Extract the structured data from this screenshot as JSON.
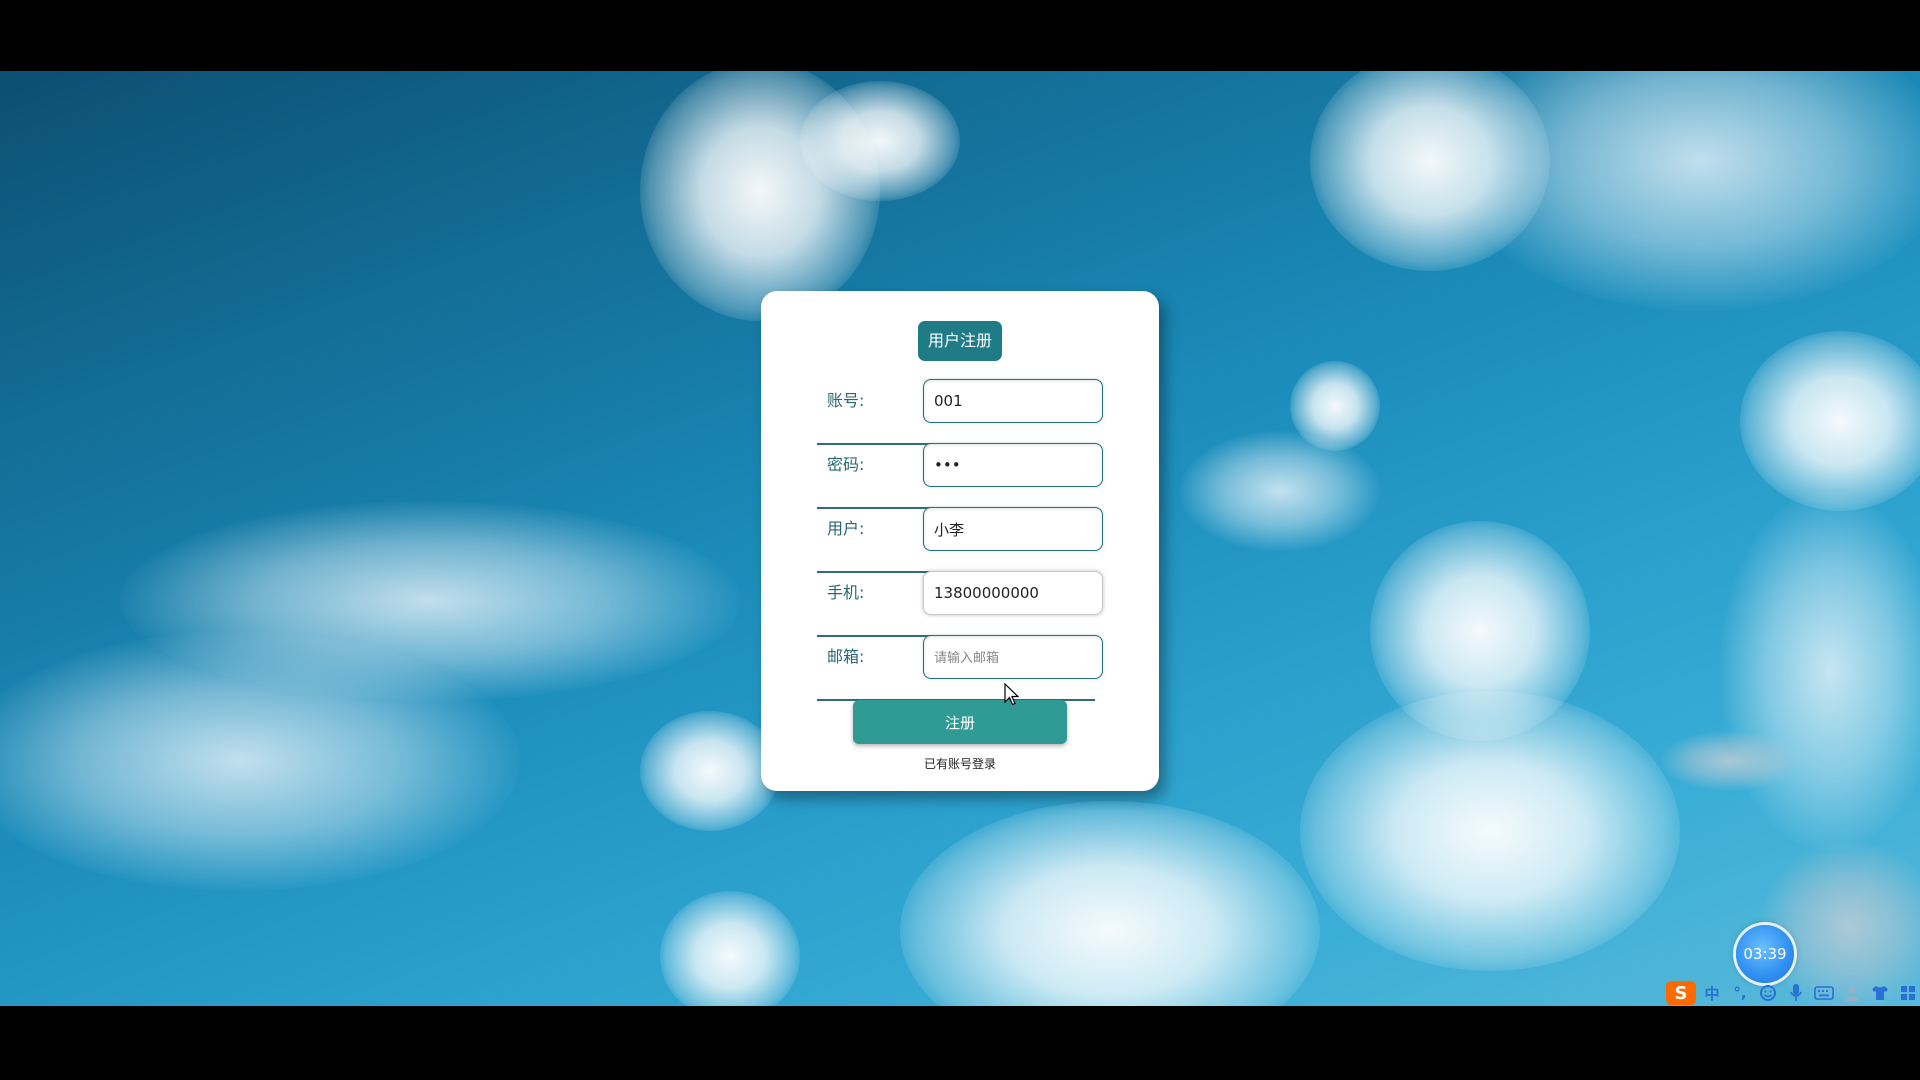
{
  "form": {
    "title": "用户注册",
    "fields": [
      {
        "label": "账号:",
        "value": "001",
        "placeholder": "",
        "type": "text"
      },
      {
        "label": "密码:",
        "value": "•••",
        "placeholder": "",
        "type": "text"
      },
      {
        "label": "用户:",
        "value": "小李",
        "placeholder": "",
        "type": "text"
      },
      {
        "label": "手机:",
        "value": "13800000000",
        "placeholder": "",
        "type": "text"
      },
      {
        "label": "邮箱:",
        "value": "",
        "placeholder": "请输入邮箱",
        "type": "text"
      }
    ],
    "submit_label": "注册",
    "login_link": "已有账号登录"
  },
  "clock": {
    "time": "03:39"
  },
  "ime": {
    "logo": "S",
    "mode": "中",
    "punct": "°,",
    "icons": [
      "emoji-icon",
      "microphone-icon",
      "keyboard-icon",
      "user-icon",
      "skin-icon",
      "toolbox-icon"
    ]
  },
  "colors": {
    "accent": "#1f7c86",
    "button": "#2f9b94",
    "label": "#2a6672"
  }
}
